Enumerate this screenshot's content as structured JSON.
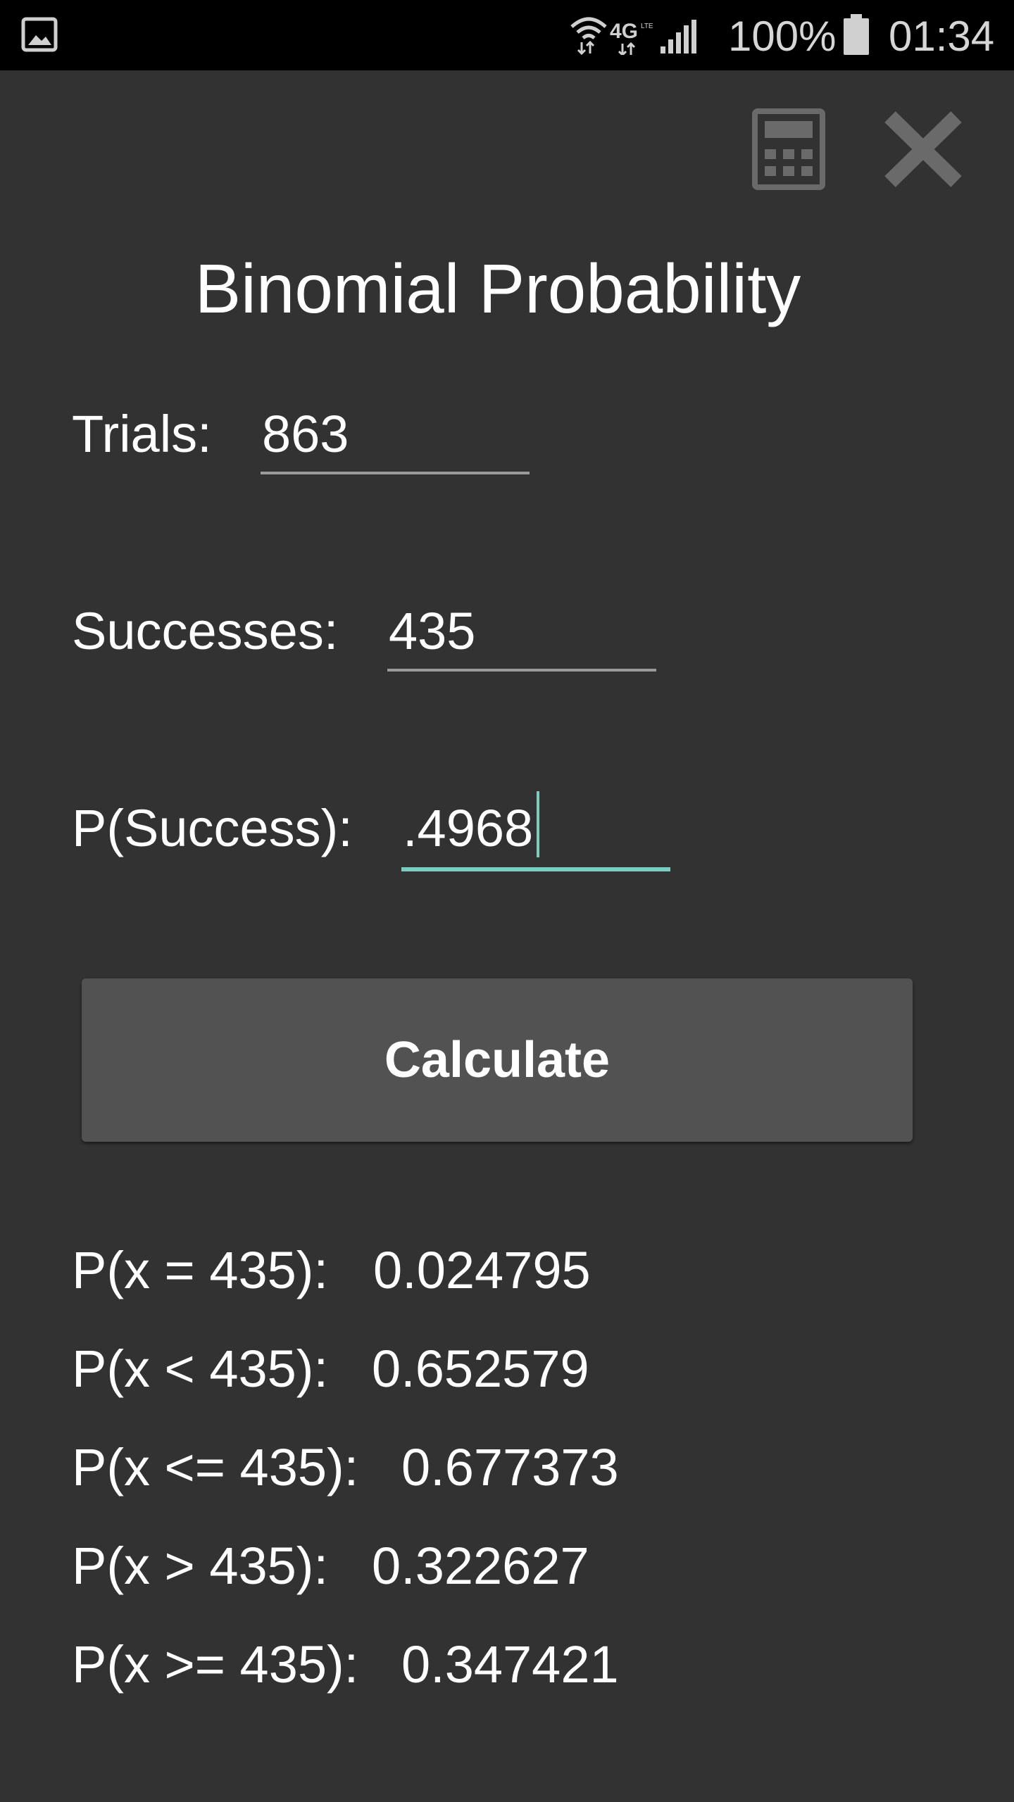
{
  "status_bar": {
    "battery_text": "100%",
    "time": "01:34",
    "network": "4G LTE",
    "icons": [
      "gallery-icon",
      "wifi-icon",
      "lte-icon",
      "signal-icon",
      "battery-icon"
    ]
  },
  "toolbar": {
    "calculator_icon": "calculator-icon",
    "close_icon": "close-icon"
  },
  "title": "Binomial Probability",
  "form": {
    "trials": {
      "label": "Trials:",
      "value": "863"
    },
    "successes": {
      "label": "Successes:",
      "value": "435"
    },
    "p_success": {
      "label": "P(Success):",
      "value": ".4968"
    }
  },
  "calculate_label": "Calculate",
  "results": [
    {
      "label": "P(x = 435):",
      "value": "0.024795"
    },
    {
      "label": "P(x < 435):",
      "value": "0.652579"
    },
    {
      "label": "P(x <= 435):",
      "value": "0.677373"
    },
    {
      "label": "P(x > 435):",
      "value": "0.322627"
    },
    {
      "label": "P(x >= 435):",
      "value": "0.347421"
    }
  ],
  "colors": {
    "background": "#323232",
    "status_bar": "#000000",
    "accent": "#7fcbc0",
    "button": "#525252",
    "icon_gray": "#6a6a6a"
  }
}
